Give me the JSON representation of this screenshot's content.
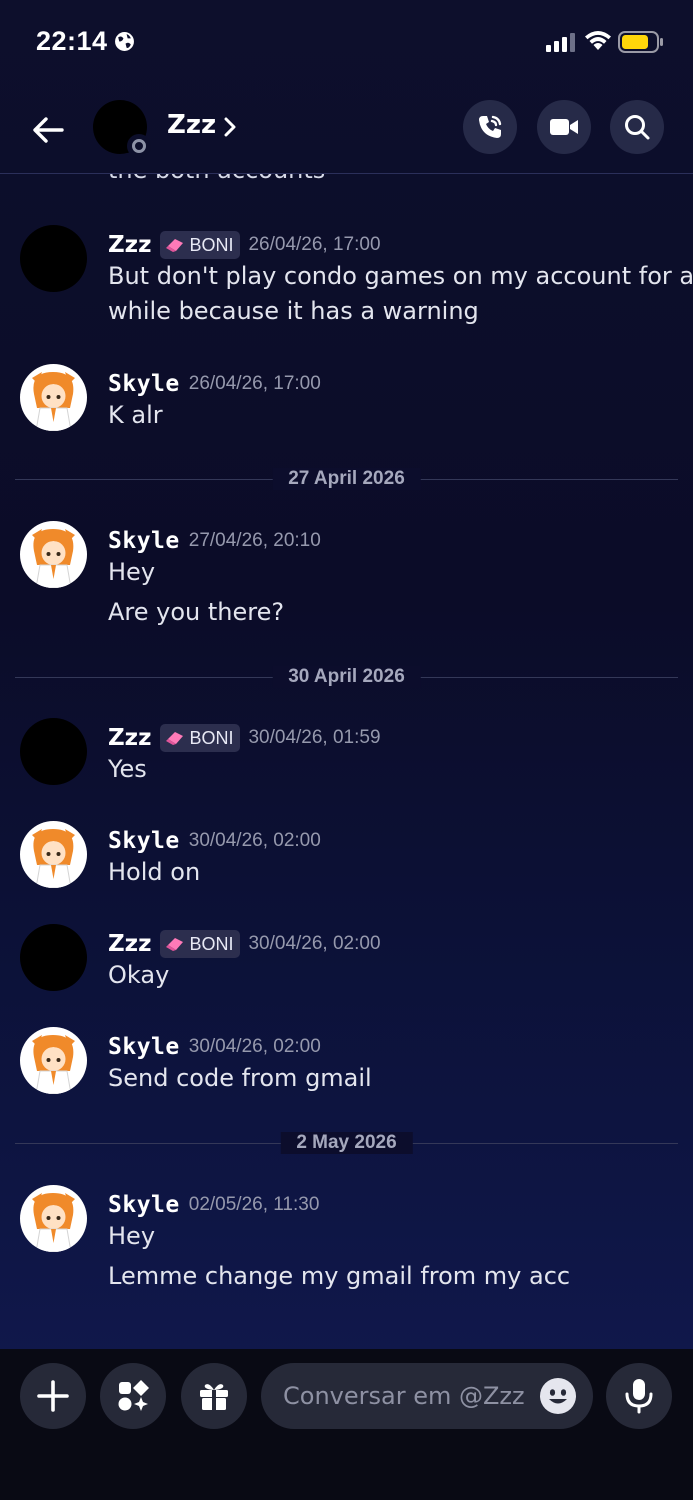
{
  "status_bar": {
    "time": "22:14",
    "icons": [
      "globe-icon",
      "cellular-signal-icon",
      "wifi-icon",
      "battery-icon"
    ],
    "battery_color": "#ffd60a"
  },
  "header": {
    "contact_name": "Zzz",
    "buttons": [
      "back-arrow-icon",
      "voice-call-icon",
      "video-call-icon",
      "search-icon"
    ]
  },
  "colors": {
    "background": "#0d0f2c",
    "tag_background": "#2c2e4e",
    "timestamp": "#9699ad",
    "divider_text": "#a5a8bd"
  },
  "messages": {
    "partial_top": "the both accounts",
    "m1": {
      "author": "Zzz",
      "tag": "BONI",
      "time": "26/04/26, 17:00",
      "lines": [
        "But don't play condo games on my account for a",
        "while because it has a warning"
      ]
    },
    "m2": {
      "author": "Skyle",
      "time": "26/04/26, 17:00",
      "lines": [
        "K alr"
      ]
    },
    "d1": "27 April 2026",
    "m3": {
      "author": "Skyle",
      "time": "27/04/26, 20:10",
      "lines": [
        "Hey",
        "Are you there?"
      ]
    },
    "d2": "30 April 2026",
    "m4": {
      "author": "Zzz",
      "tag": "BONI",
      "time": "30/04/26, 01:59",
      "lines": [
        "Yes"
      ]
    },
    "m5": {
      "author": "Skyle",
      "time": "30/04/26, 02:00",
      "lines": [
        "Hold on"
      ]
    },
    "m6": {
      "author": "Zzz",
      "tag": "BONI",
      "time": "30/04/26, 02:00",
      "lines": [
        "Okay"
      ]
    },
    "m7": {
      "author": "Skyle",
      "time": "30/04/26, 02:00",
      "lines": [
        "Send code from gmail"
      ]
    },
    "d3": "2 May 2026",
    "m8": {
      "author": "Skyle",
      "time": "02/05/26, 11:30",
      "lines": [
        "Hey",
        "Lemme change my gmail from my acc"
      ]
    }
  },
  "composer": {
    "placeholder": "Conversar em @Zzz",
    "buttons": [
      "plus-icon",
      "apps-icon",
      "gift-icon",
      "emoji-icon",
      "microphone-icon"
    ]
  }
}
